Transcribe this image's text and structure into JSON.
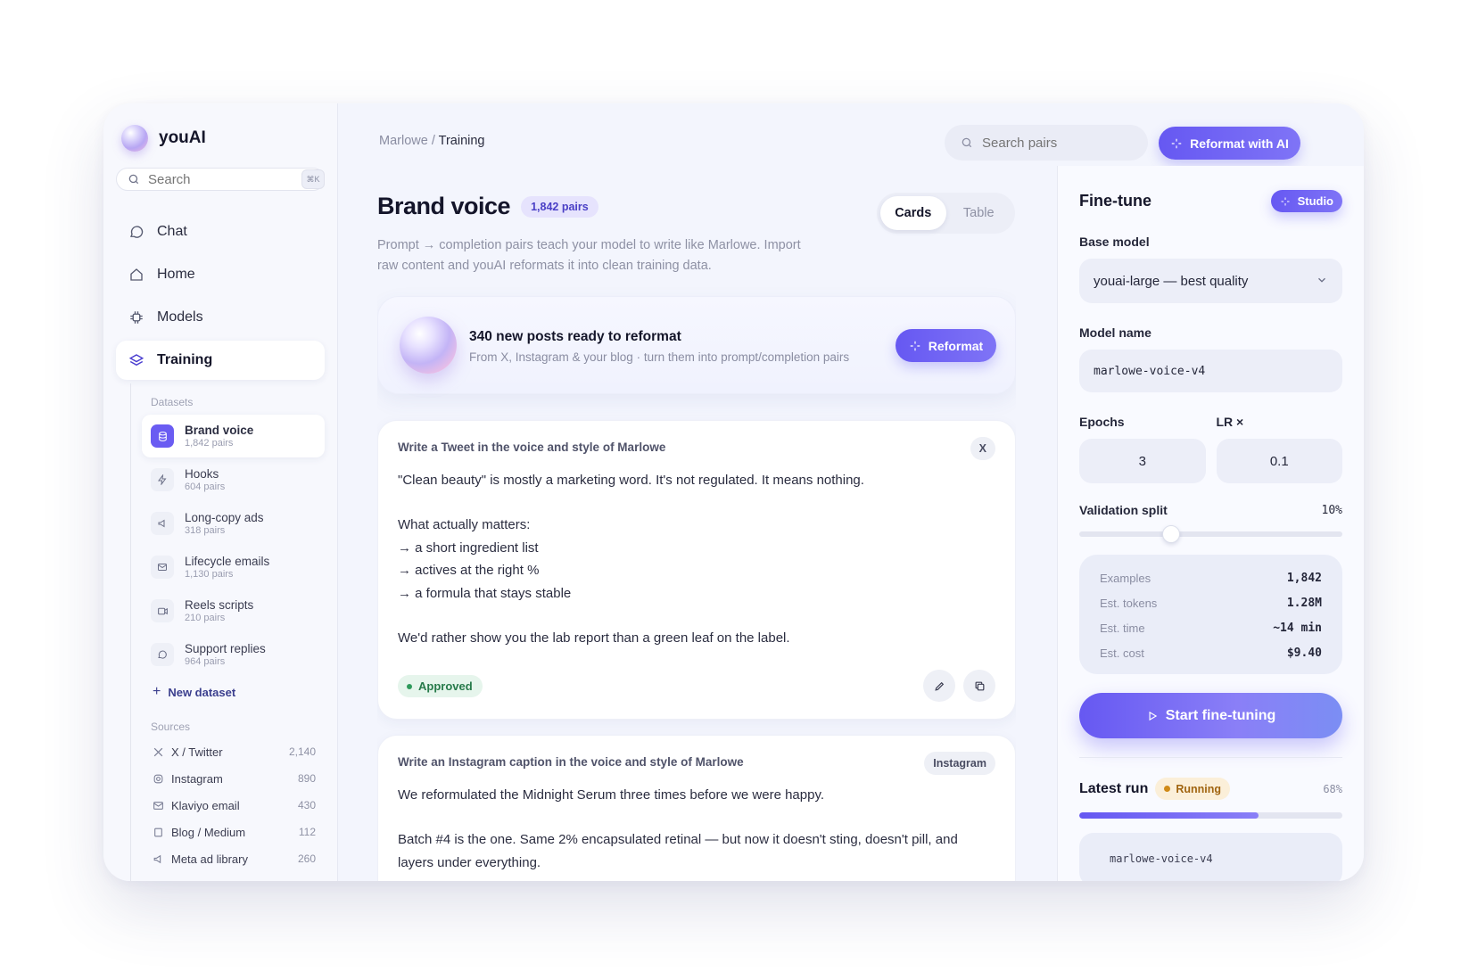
{
  "app": {
    "name": "youAI"
  },
  "sidebar": {
    "search_placeholder": "Search",
    "search_shortcut": "⌘K",
    "nav": [
      {
        "label": "Chat",
        "icon": "chat-icon"
      },
      {
        "label": "Home",
        "icon": "home-icon"
      },
      {
        "label": "Models",
        "icon": "chip-icon"
      },
      {
        "label": "Training",
        "icon": "layers-icon",
        "active": true
      }
    ],
    "datasets_label": "Datasets",
    "datasets": [
      {
        "name": "Brand voice",
        "count": "1,842 pairs",
        "active": true
      },
      {
        "name": "Hooks",
        "count": "604 pairs"
      },
      {
        "name": "Long-copy ads",
        "count": "318 pairs"
      },
      {
        "name": "Lifecycle emails",
        "count": "1,130 pairs"
      },
      {
        "name": "Reels scripts",
        "count": "210 pairs"
      },
      {
        "name": "Support replies",
        "count": "964 pairs"
      }
    ],
    "new_dataset": "New dataset",
    "sources_label": "Sources",
    "sources": [
      {
        "name": "X / Twitter",
        "count": "2,140"
      },
      {
        "name": "Instagram",
        "count": "890"
      },
      {
        "name": "Klaviyo email",
        "count": "430"
      },
      {
        "name": "Blog / Medium",
        "count": "112"
      },
      {
        "name": "Meta ad library",
        "count": "260"
      }
    ]
  },
  "header": {
    "breadcrumb_parent": "Marlowe",
    "breadcrumb_sep": "/",
    "breadcrumb_current": "Training",
    "search_placeholder": "Search pairs",
    "reformat_button": "Reformat with AI"
  },
  "main": {
    "title": "Brand voice",
    "pairs_badge": "1,842 pairs",
    "view_tabs": [
      "Cards",
      "Table"
    ],
    "subtitle": "Prompt → completion pairs teach your model to write like Marlowe. Import raw content and youAI reformats it into clean training data.",
    "banner": {
      "title": "340 new posts ready to reformat",
      "subtitle": "From X, Instagram & your blog · turn them into prompt/completion pairs",
      "button": "Reformat"
    },
    "cards": [
      {
        "prompt": "Write a Tweet in the voice and style of Marlowe",
        "tag": "X",
        "lines": [
          "\"Clean beauty\" is mostly a marketing word. It's not regulated. It means nothing.",
          "",
          "What actually matters:",
          "→ a short ingredient list",
          "→ actives at the right %",
          "→ a formula that stays stable",
          "",
          "We'd rather show you the lab report than a green leaf on the label."
        ],
        "status": "Approved"
      },
      {
        "prompt": "Write an Instagram caption in the voice and style of Marlowe",
        "tag": "Instagram",
        "lines": [
          "We reformulated the Midnight Serum three times before we were happy.",
          "",
          "Batch #4 is the one. Same 2% encapsulated retinal — but now it doesn't sting, doesn't pill, and layers under everything."
        ]
      }
    ]
  },
  "finetune": {
    "title": "Fine-tune",
    "studio_badge": "Studio",
    "base_model_label": "Base model",
    "base_model_value": "youai-large — best quality",
    "model_name_label": "Model name",
    "model_name_value": "marlowe-voice-v4",
    "epochs_label": "Epochs",
    "epochs_value": "3",
    "lr_label": "LR ×",
    "lr_value": "0.1",
    "validation_label": "Validation split",
    "validation_value": "10%",
    "validation_fraction": 0.35,
    "stats": [
      {
        "label": "Examples",
        "value": "1,842"
      },
      {
        "label": "Est. tokens",
        "value": "1.28M"
      },
      {
        "label": "Est. time",
        "value": "~14 min"
      },
      {
        "label": "Est. cost",
        "value": "$9.40"
      }
    ],
    "start_button": "Start fine-tuning",
    "latest_run_label": "Latest run",
    "run_status": "Running",
    "run_progress_text": "68%",
    "run_progress": 0.68,
    "run_log": "marlowe-voice-v4"
  },
  "colors": {
    "accent": "#6658f2",
    "approved": "#2e9a5b",
    "running": "#d08a18"
  }
}
